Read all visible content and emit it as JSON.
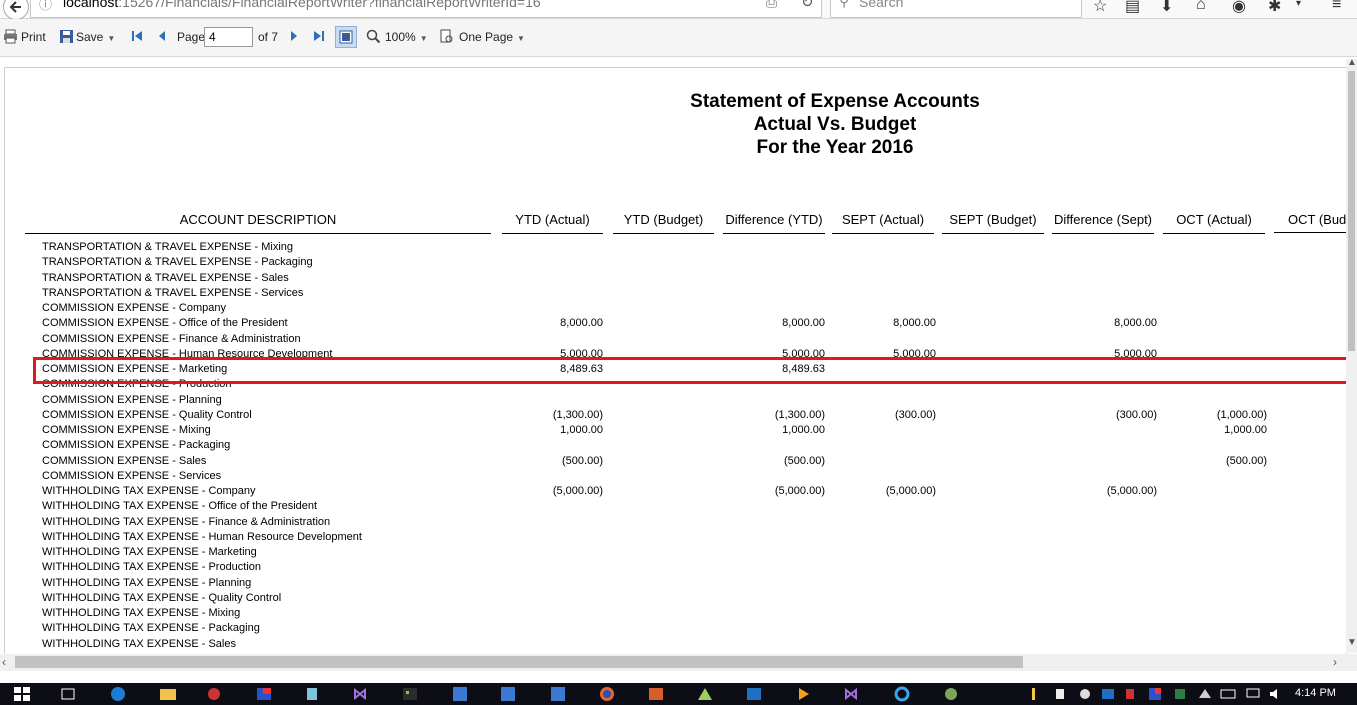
{
  "browser": {
    "url_host": "localhost",
    "url_rest": ":15267/Financials/FinancialReportWriter?financialReportWriterId=16",
    "search_placeholder": "Search"
  },
  "toolbar": {
    "print_label": "Print",
    "save_label": "Save",
    "page_label": "Page",
    "page_value": "4",
    "page_of": "of 7",
    "zoom_label": "100%",
    "view_label": "One Page"
  },
  "report": {
    "title_lines": [
      "Statement of Expense Accounts",
      "Actual Vs. Budget",
      "For the Year 2016"
    ],
    "columns": [
      "ACCOUNT DESCRIPTION",
      "YTD (Actual)",
      "YTD (Budget)",
      "Difference (YTD)",
      "SEPT (Actual)",
      "SEPT (Budget)",
      "Difference (Sept)",
      "OCT (Actual)",
      "OCT (Budg"
    ],
    "rows": [
      {
        "desc": "TRANSPORTATION & TRAVEL EXPENSE - Mixing",
        "ytd_actual": "",
        "ytd_diff": "",
        "sept_actual": "",
        "sept_diff": "",
        "oct_actual": ""
      },
      {
        "desc": "TRANSPORTATION & TRAVEL EXPENSE - Packaging",
        "ytd_actual": "",
        "ytd_diff": "",
        "sept_actual": "",
        "sept_diff": "",
        "oct_actual": ""
      },
      {
        "desc": "TRANSPORTATION & TRAVEL EXPENSE - Sales",
        "ytd_actual": "",
        "ytd_diff": "",
        "sept_actual": "",
        "sept_diff": "",
        "oct_actual": ""
      },
      {
        "desc": "TRANSPORTATION & TRAVEL EXPENSE - Services",
        "ytd_actual": "",
        "ytd_diff": "",
        "sept_actual": "",
        "sept_diff": "",
        "oct_actual": ""
      },
      {
        "desc": "COMMISSION EXPENSE - Company",
        "ytd_actual": "",
        "ytd_diff": "",
        "sept_actual": "",
        "sept_diff": "",
        "oct_actual": ""
      },
      {
        "desc": "COMMISSION EXPENSE - Office of the President",
        "ytd_actual": "8,000.00",
        "ytd_diff": "8,000.00",
        "sept_actual": "8,000.00",
        "sept_diff": "8,000.00",
        "oct_actual": ""
      },
      {
        "desc": "COMMISSION EXPENSE - Finance & Administration",
        "ytd_actual": "",
        "ytd_diff": "",
        "sept_actual": "",
        "sept_diff": "",
        "oct_actual": ""
      },
      {
        "desc": "COMMISSION EXPENSE - Human Resource Development",
        "ytd_actual": "5,000.00",
        "ytd_diff": "5,000.00",
        "sept_actual": "5,000.00",
        "sept_diff": "5,000.00",
        "oct_actual": ""
      },
      {
        "desc": "COMMISSION EXPENSE - Marketing",
        "ytd_actual": "8,489.63",
        "ytd_diff": "8,489.63",
        "sept_actual": "",
        "sept_diff": "",
        "oct_actual": ""
      },
      {
        "desc": "COMMISSION EXPENSE - Production",
        "ytd_actual": "",
        "ytd_diff": "",
        "sept_actual": "",
        "sept_diff": "",
        "oct_actual": ""
      },
      {
        "desc": "COMMISSION EXPENSE - Planning",
        "ytd_actual": "",
        "ytd_diff": "",
        "sept_actual": "",
        "sept_diff": "",
        "oct_actual": ""
      },
      {
        "desc": "COMMISSION EXPENSE - Quality Control",
        "ytd_actual": "(1,300.00)",
        "ytd_diff": "(1,300.00)",
        "sept_actual": "(300.00)",
        "sept_diff": "(300.00)",
        "oct_actual": "(1,000.00)"
      },
      {
        "desc": "COMMISSION EXPENSE - Mixing",
        "ytd_actual": "1,000.00",
        "ytd_diff": "1,000.00",
        "sept_actual": "",
        "sept_diff": "",
        "oct_actual": "1,000.00"
      },
      {
        "desc": "COMMISSION EXPENSE - Packaging",
        "ytd_actual": "",
        "ytd_diff": "",
        "sept_actual": "",
        "sept_diff": "",
        "oct_actual": ""
      },
      {
        "desc": "COMMISSION EXPENSE - Sales",
        "ytd_actual": "(500.00)",
        "ytd_diff": "(500.00)",
        "sept_actual": "",
        "sept_diff": "",
        "oct_actual": "(500.00)"
      },
      {
        "desc": "COMMISSION EXPENSE - Services",
        "ytd_actual": "",
        "ytd_diff": "",
        "sept_actual": "",
        "sept_diff": "",
        "oct_actual": ""
      },
      {
        "desc": "WITHHOLDING TAX EXPENSE - Company",
        "ytd_actual": "(5,000.00)",
        "ytd_diff": "(5,000.00)",
        "sept_actual": "(5,000.00)",
        "sept_diff": "(5,000.00)",
        "oct_actual": ""
      },
      {
        "desc": "WITHHOLDING TAX EXPENSE - Office of the President",
        "ytd_actual": "",
        "ytd_diff": "",
        "sept_actual": "",
        "sept_diff": "",
        "oct_actual": ""
      },
      {
        "desc": "WITHHOLDING TAX EXPENSE - Finance & Administration",
        "ytd_actual": "",
        "ytd_diff": "",
        "sept_actual": "",
        "sept_diff": "",
        "oct_actual": ""
      },
      {
        "desc": "WITHHOLDING TAX EXPENSE - Human Resource Development",
        "ytd_actual": "",
        "ytd_diff": "",
        "sept_actual": "",
        "sept_diff": "",
        "oct_actual": ""
      },
      {
        "desc": "WITHHOLDING TAX EXPENSE - Marketing",
        "ytd_actual": "",
        "ytd_diff": "",
        "sept_actual": "",
        "sept_diff": "",
        "oct_actual": ""
      },
      {
        "desc": "WITHHOLDING TAX EXPENSE - Production",
        "ytd_actual": "",
        "ytd_diff": "",
        "sept_actual": "",
        "sept_diff": "",
        "oct_actual": ""
      },
      {
        "desc": "WITHHOLDING TAX EXPENSE - Planning",
        "ytd_actual": "",
        "ytd_diff": "",
        "sept_actual": "",
        "sept_diff": "",
        "oct_actual": ""
      },
      {
        "desc": "WITHHOLDING TAX EXPENSE - Quality Control",
        "ytd_actual": "",
        "ytd_diff": "",
        "sept_actual": "",
        "sept_diff": "",
        "oct_actual": ""
      },
      {
        "desc": "WITHHOLDING TAX EXPENSE - Mixing",
        "ytd_actual": "",
        "ytd_diff": "",
        "sept_actual": "",
        "sept_diff": "",
        "oct_actual": ""
      },
      {
        "desc": "WITHHOLDING TAX EXPENSE - Packaging",
        "ytd_actual": "",
        "ytd_diff": "",
        "sept_actual": "",
        "sept_diff": "",
        "oct_actual": ""
      },
      {
        "desc": "WITHHOLDING TAX EXPENSE - Sales",
        "ytd_actual": "",
        "ytd_diff": "",
        "sept_actual": "",
        "sept_diff": "",
        "oct_actual": ""
      }
    ],
    "highlight_color": "#e0191f"
  },
  "taskbar": {
    "clock": "4:14 PM"
  },
  "icons": [
    "back-arrow-icon",
    "info-icon",
    "reader-view-icon",
    "reload-icon",
    "search-icon",
    "star-icon",
    "reading-list-icon",
    "download-icon",
    "home-icon",
    "pocket-icon",
    "extension-icon",
    "menu-icon",
    "printer-icon",
    "save-disk-icon",
    "first-page-icon",
    "previous-page-icon",
    "next-page-icon",
    "last-page-icon",
    "single-page-view-icon",
    "zoom-icon",
    "page-layout-icon"
  ]
}
